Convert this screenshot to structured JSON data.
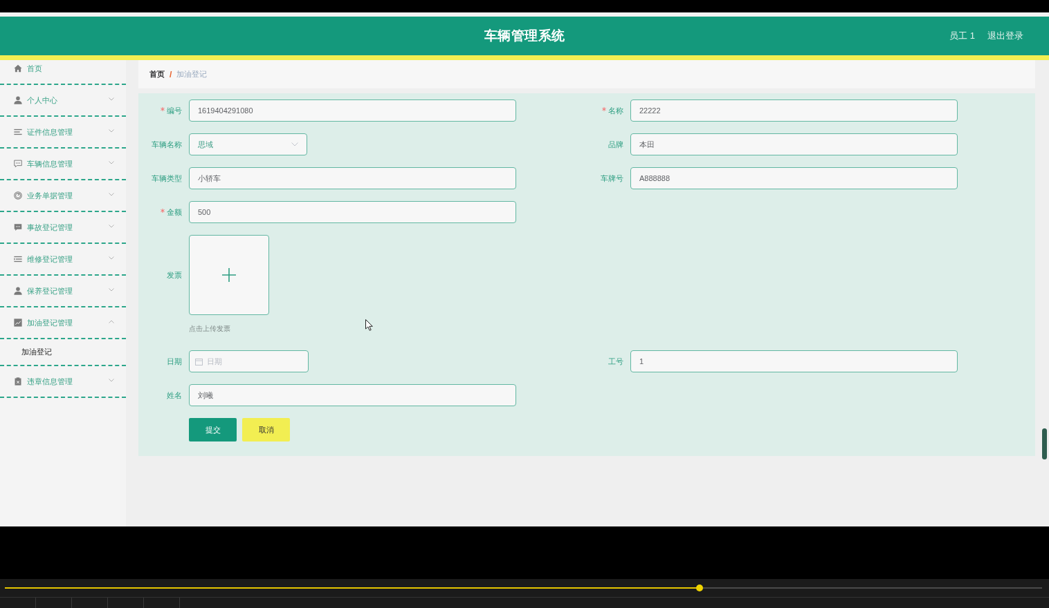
{
  "header": {
    "title": "车辆管理系统",
    "user": "员工 1",
    "logout": "退出登录"
  },
  "sidebar": {
    "items": [
      {
        "label": "首页",
        "kind": "link"
      },
      {
        "label": "个人中心",
        "kind": "menu",
        "expanded": false
      },
      {
        "label": "证件信息管理",
        "kind": "menu",
        "expanded": false
      },
      {
        "label": "车辆信息管理",
        "kind": "menu",
        "expanded": false
      },
      {
        "label": "业务单据管理",
        "kind": "menu",
        "expanded": false
      },
      {
        "label": "事故登记管理",
        "kind": "menu",
        "expanded": false
      },
      {
        "label": "维修登记管理",
        "kind": "menu",
        "expanded": false
      },
      {
        "label": "保养登记管理",
        "kind": "menu",
        "expanded": false
      },
      {
        "label": "加油登记管理",
        "kind": "menu",
        "expanded": true,
        "children": [
          {
            "label": "加油登记"
          }
        ]
      },
      {
        "label": "违章信息管理",
        "kind": "menu",
        "expanded": false
      }
    ]
  },
  "breadcrumb": {
    "items": [
      "首页",
      "加油登记"
    ],
    "separator": "/"
  },
  "form": {
    "rows": [
      [
        {
          "label": "编号",
          "kind": "text",
          "required": true,
          "value": "1619404291080"
        },
        {
          "label": "名称",
          "kind": "text",
          "required": true,
          "value": "22222"
        }
      ],
      [
        {
          "label": "车辆名称",
          "kind": "select",
          "required": false,
          "value": "思域"
        },
        {
          "label": "品牌",
          "kind": "text",
          "required": false,
          "value": "本田"
        }
      ],
      [
        {
          "label": "车辆类型",
          "kind": "text",
          "required": false,
          "value": "小轿车"
        },
        {
          "label": "车牌号",
          "kind": "text",
          "required": false,
          "value": "A888888"
        }
      ],
      [
        {
          "label": "金额",
          "kind": "text",
          "required": true,
          "value": "500"
        }
      ],
      [
        {
          "label": "发票",
          "kind": "upload",
          "required": false,
          "hint": "点击上传发票"
        }
      ],
      [
        {
          "label": "日期",
          "kind": "date",
          "required": false,
          "placeholder": "日期"
        },
        {
          "label": "工号",
          "kind": "text",
          "required": false,
          "value": "1"
        }
      ],
      [
        {
          "label": "姓名",
          "kind": "text",
          "required": false,
          "value": "刘曦"
        }
      ]
    ],
    "buttons": [
      {
        "label": "提交",
        "kind": "primary"
      },
      {
        "label": "取消",
        "kind": "cancel"
      }
    ]
  },
  "player": {
    "progress": {
      "level": 0.67
    }
  }
}
